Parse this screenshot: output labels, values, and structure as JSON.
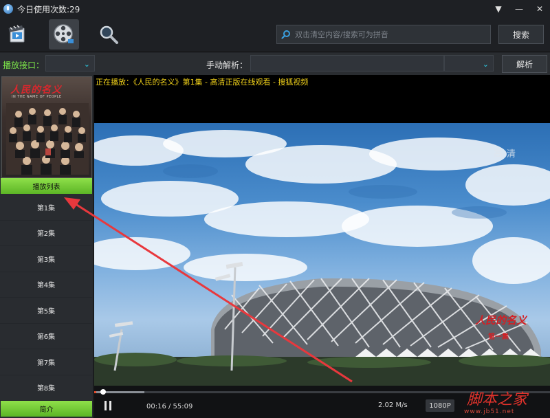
{
  "window": {
    "title": "今日使用次数:29",
    "menu_icon": "chevron-down-icon",
    "min_icon": "minimize-icon",
    "close_icon": "close-icon",
    "menu_glyph": "▼",
    "min_glyph": "—",
    "close_glyph": "✕"
  },
  "toolbar": {
    "search_placeholder": "双击清空内容/搜索可为拼音",
    "search_button": "搜索"
  },
  "interface": {
    "label": "播放接口：",
    "manual_label": "手动解析：",
    "parse_button": "解析",
    "chevron_glyph": "⌄",
    "accent_color": "#7ee84a"
  },
  "sidebar": {
    "poster_title": "人民的名义",
    "poster_subtitle": "IN THE NAME OF PEOPLE",
    "playlist_header": "播放列表",
    "episodes": [
      "第1集",
      "第2集",
      "第3集",
      "第4集",
      "第5集",
      "第6集",
      "第7集",
      "第8集"
    ],
    "intro_button": "简介"
  },
  "player": {
    "now_playing": "正在播放：《人民的名义》第1集 - 高清正版在线观看 - 搜狐视频",
    "hd_mark": "高清",
    "video_logo": "人民的名义",
    "video_logo_sub": "第一集",
    "time": "00:16 / 55:09",
    "speed": "2.02 M/s",
    "quality": "1080P",
    "progress": 0.005,
    "buffered": 0.11
  },
  "watermark": {
    "main": "脚本之家",
    "url": "www.jb51.net"
  },
  "colors": {
    "annotation_arrow": "#e8383d",
    "playlist_green": "#7ee84a",
    "now_playing": "#f2d21a"
  }
}
